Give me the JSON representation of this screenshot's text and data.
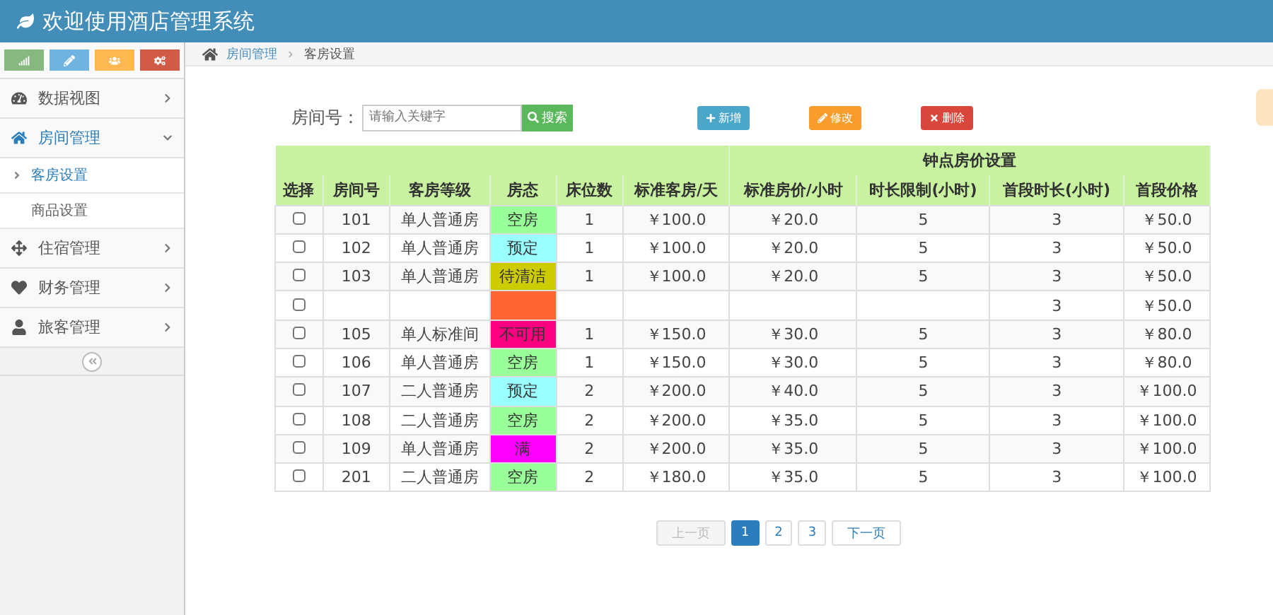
{
  "header": {
    "title": "欢迎使用酒店管理系统"
  },
  "shortcuts": [
    {
      "kind": "chart",
      "color": "#87b87f"
    },
    {
      "kind": "pencil",
      "color": "#6fb3e0"
    },
    {
      "kind": "users",
      "color": "#ffb752"
    },
    {
      "kind": "cogs",
      "color": "#d15b47"
    }
  ],
  "sidebar": {
    "items": [
      {
        "kind": "dashboard",
        "label": "数据视图",
        "expanded": false
      },
      {
        "kind": "home",
        "label": "房间管理",
        "expanded": true,
        "children": [
          {
            "label": "客房设置",
            "selected": true
          },
          {
            "label": "商品设置",
            "selected": false
          }
        ]
      },
      {
        "kind": "move",
        "label": "住宿管理",
        "expanded": false
      },
      {
        "kind": "heart",
        "label": "财务管理",
        "expanded": false
      },
      {
        "kind": "user",
        "label": "旅客管理",
        "expanded": false
      }
    ]
  },
  "breadcrumb": [
    "房间管理",
    "客房设置"
  ],
  "search": {
    "label": "房间号：",
    "placeholder": "请输入关键字",
    "button": "搜索"
  },
  "actions": [
    {
      "kind": "add",
      "label": "新增"
    },
    {
      "kind": "edit",
      "label": "修改"
    },
    {
      "kind": "delete",
      "label": "删除"
    }
  ],
  "table": {
    "group_header": "钟点房价设置",
    "columns": [
      "选择",
      "房间号",
      "客房等级",
      "房态",
      "床位数",
      "标准客房/天",
      "标准房价/小时",
      "时长限制(小时)",
      "首段时长(小时)",
      "首段价格"
    ],
    "rows": [
      {
        "checked": false,
        "room": "101",
        "grade": "单人普通房",
        "status": "空房",
        "color": "#99ff99",
        "beds": "1",
        "day_price": "￥100.0",
        "hour_price": "￥20.0",
        "limit": "5",
        "first_hours": "3",
        "first_price": "￥50.0"
      },
      {
        "checked": false,
        "room": "102",
        "grade": "单人普通房",
        "status": "预定",
        "color": "#99ffff",
        "beds": "1",
        "day_price": "￥100.0",
        "hour_price": "￥20.0",
        "limit": "5",
        "first_hours": "3",
        "first_price": "￥50.0"
      },
      {
        "checked": false,
        "room": "103",
        "grade": "单人普通房",
        "status": "待清洁",
        "color": "#cccc00",
        "beds": "1",
        "day_price": "￥100.0",
        "hour_price": "￥20.0",
        "limit": "5",
        "first_hours": "3",
        "first_price": "￥50.0"
      },
      {
        "checked": false,
        "color": "#ff6633",
        "first_hours": "3",
        "first_price": "￥50.0"
      },
      {
        "checked": false,
        "room": "105",
        "grade": "单人标准间",
        "status": "不可用",
        "color": "#ff0080",
        "beds": "1",
        "day_price": "￥150.0",
        "hour_price": "￥30.0",
        "limit": "5",
        "first_hours": "3",
        "first_price": "￥80.0"
      },
      {
        "checked": false,
        "room": "106",
        "grade": "单人普通房",
        "status": "空房",
        "color": "#99ff99",
        "beds": "1",
        "day_price": "￥150.0",
        "hour_price": "￥30.0",
        "limit": "5",
        "first_hours": "3",
        "first_price": "￥80.0"
      },
      {
        "checked": false,
        "room": "107",
        "grade": "二人普通房",
        "status": "预定",
        "color": "#99ffff",
        "beds": "2",
        "day_price": "￥200.0",
        "hour_price": "￥40.0",
        "limit": "5",
        "first_hours": "3",
        "first_price": "￥100.0"
      },
      {
        "checked": false,
        "room": "108",
        "grade": "二人普通房",
        "status": "空房",
        "color": "#99ff99",
        "beds": "2",
        "day_price": "￥200.0",
        "hour_price": "￥35.0",
        "limit": "5",
        "first_hours": "3",
        "first_price": "￥100.0"
      },
      {
        "checked": false,
        "room": "109",
        "grade": "单人普通房",
        "status": "满",
        "color": "#ff00ff",
        "beds": "2",
        "day_price": "￥200.0",
        "hour_price": "￥35.0",
        "limit": "5",
        "first_hours": "3",
        "first_price": "￥100.0"
      },
      {
        "checked": false,
        "room": "201",
        "grade": "二人普通房",
        "status": "空房",
        "color": "#99ff99",
        "beds": "2",
        "day_price": "￥180.0",
        "hour_price": "￥35.0",
        "limit": "5",
        "first_hours": "3",
        "first_price": "￥100.0"
      }
    ]
  },
  "pagination": [
    {
      "kind": "prev",
      "label": "上一页",
      "selected": false,
      "disabled": true
    },
    {
      "kind": "page",
      "label": "1",
      "selected": true,
      "disabled": false
    },
    {
      "kind": "page",
      "label": "2",
      "selected": false,
      "disabled": false
    },
    {
      "kind": "page",
      "label": "3",
      "selected": false,
      "disabled": false
    },
    {
      "kind": "next",
      "label": "下一页",
      "selected": false,
      "disabled": false
    }
  ]
}
